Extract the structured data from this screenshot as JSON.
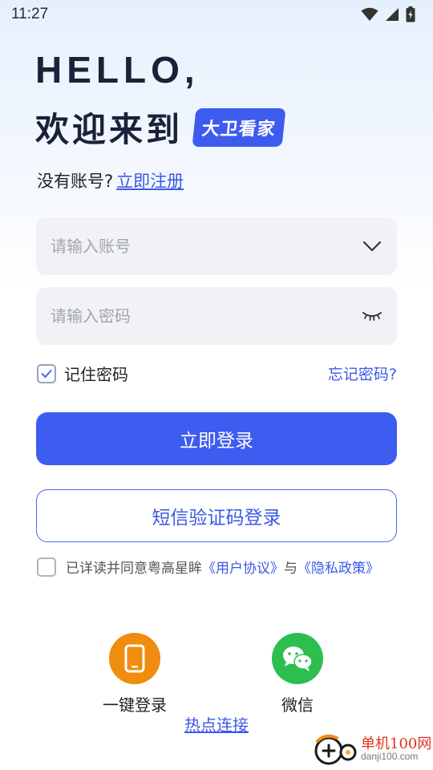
{
  "status_bar": {
    "time": "11:27"
  },
  "header": {
    "hello": "HELLO,",
    "welcome": "欢迎来到",
    "brand": "大卫看家"
  },
  "register": {
    "prompt": "没有账号?",
    "link": "立即注册"
  },
  "form": {
    "account_placeholder": "请输入账号",
    "account_value": "",
    "password_placeholder": "请输入密码",
    "password_value": "",
    "remember_label": "记住密码",
    "remember_checked": true,
    "forgot_label": "忘记密码?"
  },
  "buttons": {
    "login": "立即登录",
    "sms_login": "短信验证码登录"
  },
  "agreement": {
    "checked": false,
    "prefix": "已详读并同意粤高星眸",
    "user_agreement": "《用户协议》",
    "conjunction": "与",
    "privacy_policy": "《隐私政策》"
  },
  "alt_login": {
    "one_click": {
      "label": "一键登录",
      "icon": "phone-icon",
      "color": "#f08c0e"
    },
    "wechat": {
      "label": "微信",
      "icon": "wechat-icon",
      "color": "#2cbf4f"
    }
  },
  "hotspot_link": "热点连接",
  "watermark": {
    "name": "单机100网",
    "url": "danji100.com"
  },
  "colors": {
    "accent": "#3d5cf0",
    "link": "#3b58e8"
  }
}
